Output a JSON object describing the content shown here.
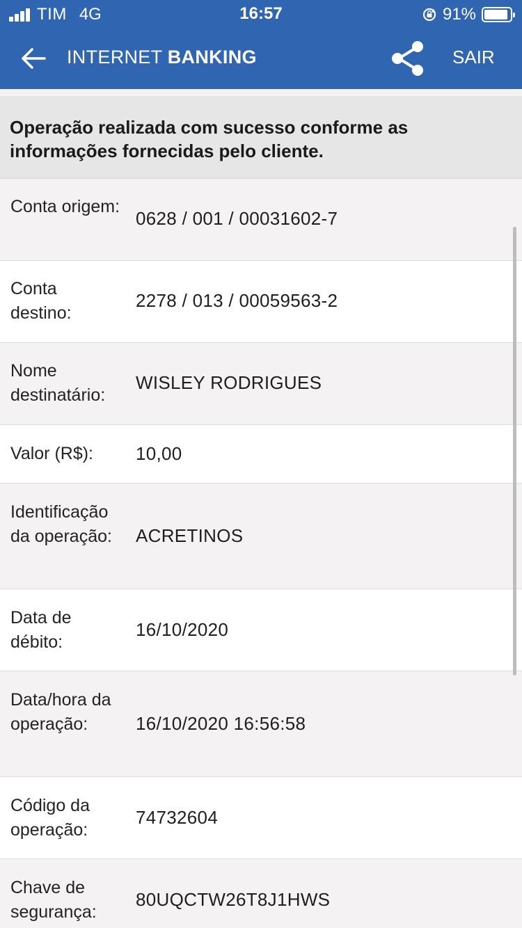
{
  "status_bar": {
    "carrier": "TIM",
    "network": "4G",
    "time": "16:57",
    "battery_percent": "91%",
    "battery_level": 0.91
  },
  "header": {
    "title_regular": "INTERNET",
    "title_bold": "BANKING",
    "logout_label": "SAIR",
    "background_color": "#3065b1"
  },
  "banner": {
    "message": "Operação realizada com sucesso conforme as informações fornecidas pelo cliente."
  },
  "receipt": {
    "rows": [
      {
        "label": "Conta origem:",
        "value": "0628 / 001 / 00031602-7"
      },
      {
        "label": "Conta destino:",
        "value": "2278 / 013 / 00059563-2"
      },
      {
        "label": "Nome destinatário:",
        "value": "WISLEY RODRIGUES"
      },
      {
        "label": "Valor (R$):",
        "value": "10,00"
      },
      {
        "label": "Identificação da operação:",
        "value": "ACRETINOS"
      },
      {
        "label": "Data de débito:",
        "value": "16/10/2020"
      },
      {
        "label": "Data/hora da operação:",
        "value": "16/10/2020 16:56:58"
      },
      {
        "label": "Código da operação:",
        "value": "74732604"
      },
      {
        "label": "Chave de segurança:",
        "value": "80UQCTW26T8J1HWS"
      }
    ]
  },
  "icons": {
    "back": "arrow-left-icon",
    "share": "share-icon",
    "orientation_lock": "orientation-lock-icon"
  }
}
